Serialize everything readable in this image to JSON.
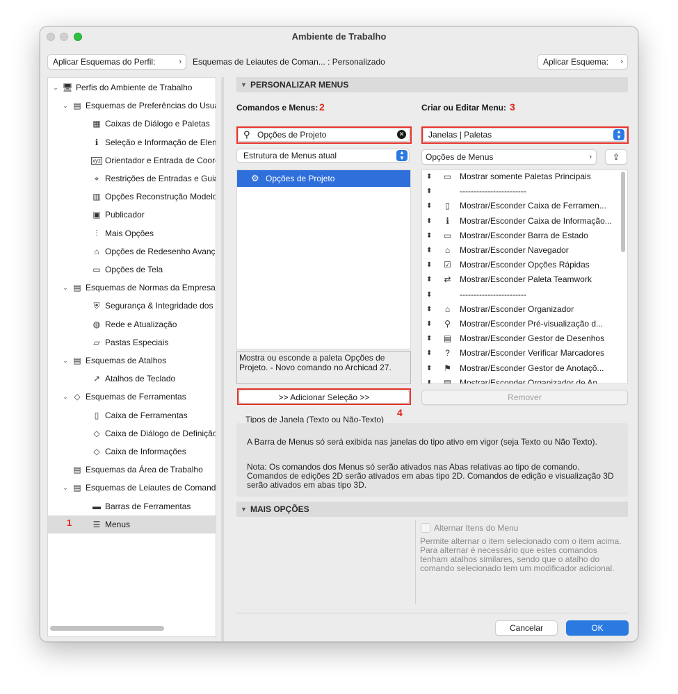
{
  "window": {
    "title": "Ambiente de Trabalho"
  },
  "toolbar": {
    "apply_profile_label": "Aplicar Esquemas do Perfil:",
    "scheme_path": "Esquemas de Leiautes de Coman... : Personalizado",
    "apply_scheme_label": "Aplicar Esquema:"
  },
  "tree": {
    "items": [
      {
        "label": "Perfis do Ambiente de Trabalho",
        "icon": "profiles-icon"
      },
      {
        "label": "Esquemas de Preferências do Usuá",
        "icon": "preferences-schemes-icon"
      },
      {
        "label": "Caixas de Diálogo e Paletas",
        "icon": "dialogs-palettes-icon"
      },
      {
        "label": "Seleção e Informação de Elemen",
        "icon": "selection-info-icon"
      },
      {
        "label": "Orientador e Entrada de Coorder",
        "icon": "xyz-icon"
      },
      {
        "label": "Restrições de Entradas e Guias",
        "icon": "mouse-constraints-icon"
      },
      {
        "label": "Opções Reconstrução Modelo",
        "icon": "rebuild-model-icon"
      },
      {
        "label": "Publicador",
        "icon": "publisher-icon"
      },
      {
        "label": "Mais Opções",
        "icon": "sliders-icon"
      },
      {
        "label": "Opções de Redesenho Avançada",
        "icon": "redraw-icon"
      },
      {
        "label": "Opções de Tela",
        "icon": "screen-options-icon"
      },
      {
        "label": "Esquemas de Normas da Empresa",
        "icon": "company-standards-icon"
      },
      {
        "label": "Segurança & Integridade dos Da",
        "icon": "security-icon"
      },
      {
        "label": "Rede e Atualização",
        "icon": "globe-icon"
      },
      {
        "label": "Pastas Especiais",
        "icon": "folder-icon"
      },
      {
        "label": "Esquemas de Atalhos",
        "icon": "shortcut-schemes-icon"
      },
      {
        "label": "Atalhos de Teclado",
        "icon": "keyboard-shortcut-icon"
      },
      {
        "label": "Esquemas de Ferramentas",
        "icon": "tool-schemes-icon"
      },
      {
        "label": "Caixa de Ferramentas",
        "icon": "toolbox-icon"
      },
      {
        "label": "Caixa de Diálogo de Definição d",
        "icon": "tool-settings-icon"
      },
      {
        "label": "Caixa de Informações",
        "icon": "info-box-icon"
      },
      {
        "label": "Esquemas da Área de Trabalho",
        "icon": "workspace-schemes-icon"
      },
      {
        "label": "Esquemas de Leiautes de Comando",
        "icon": "command-layout-icon"
      },
      {
        "label": "Barras de Ferramentas",
        "icon": "toolbars-icon"
      },
      {
        "label": "Menus",
        "icon": "menus-icon"
      }
    ],
    "selected_marker": "1"
  },
  "customize_menus": {
    "header": "PERSONALIZAR MENUS",
    "commands_label": "Comandos e Menus:",
    "commands_marker": "2",
    "create_edit_label": "Criar ou Editar Menu:",
    "create_edit_marker": "3",
    "search_value": "Opções de Projeto",
    "structure_select": "Estrutura de Menus atual",
    "selected_command": "Opções de Projeto",
    "description": "Mostra ou esconde a paleta Opções de Projeto. - Novo comando no Archicad 27.",
    "add_button": ">> Adicionar Seleção >>",
    "add_marker": "4",
    "menu_select": "Janelas | Paletas",
    "menu_options": "Opções de Menus",
    "remove_button": "Remover",
    "menu_items": [
      {
        "label": "Mostrar somente Paletas Principais",
        "icon": "palettes-icon"
      },
      {
        "label": "------------------------",
        "icon": ""
      },
      {
        "label": "Mostrar/Esconder Caixa de Ferramen...",
        "icon": "toolbox-icon"
      },
      {
        "label": "Mostrar/Esconder Caixa de Informação...",
        "icon": "info-icon"
      },
      {
        "label": "Mostrar/Esconder Barra de Estado",
        "icon": "status-bar-icon"
      },
      {
        "label": "Mostrar/Esconder Navegador",
        "icon": "navigator-icon"
      },
      {
        "label": "Mostrar/Esconder Opções Rápidas",
        "icon": "quick-options-icon"
      },
      {
        "label": "Mostrar/Esconder Paleta Teamwork",
        "icon": "teamwork-icon"
      },
      {
        "label": "------------------------",
        "icon": ""
      },
      {
        "label": "Mostrar/Esconder Organizador",
        "icon": "organizer-icon"
      },
      {
        "label": "Mostrar/Esconder Pré-visualização d...",
        "icon": "preview-icon"
      },
      {
        "label": "Mostrar/Esconder Gestor de Desenhos",
        "icon": "drawing-manager-icon"
      },
      {
        "label": "Mostrar/Esconder Verificar Marcadores",
        "icon": "check-markers-icon"
      },
      {
        "label": "Mostrar/Esconder Gestor de Anotaçõ...",
        "icon": "flag-icon"
      },
      {
        "label": "Mostrar/Esconder Organizador de An...",
        "icon": "annotation-organizer-icon"
      }
    ]
  },
  "window_types": {
    "title": "Tipos de Janela (Texto ou Não-Texto)",
    "text1": "A Barra de Menus só será exibida nas janelas do tipo ativo em vigor (seja Texto ou Não Texto).",
    "text2": "Nota: Os comandos dos Menus só serão ativados nas Abas relativas ao tipo de comando. Comandos de edições 2D serão ativados em abas tipo 2D. Comandos de edição e visualização 3D serão ativados em abas tipo 3D."
  },
  "more_options": {
    "header": "MAIS OPÇÕES",
    "toggle_label": "Alternar Itens do Menu",
    "toggle_description": "Permite alternar o item selecionado com o item acima. Para alternar é necessário que estes comandos tenham atalhos similares, sendo que o atalho do comando selecionado tem um modificador adicional."
  },
  "footer": {
    "cancel_label": "Cancelar",
    "ok_label": "OK"
  },
  "colors": {
    "accent": "#2a7ae2",
    "highlight": "#e8332a",
    "selection": "#2f6fdb"
  }
}
